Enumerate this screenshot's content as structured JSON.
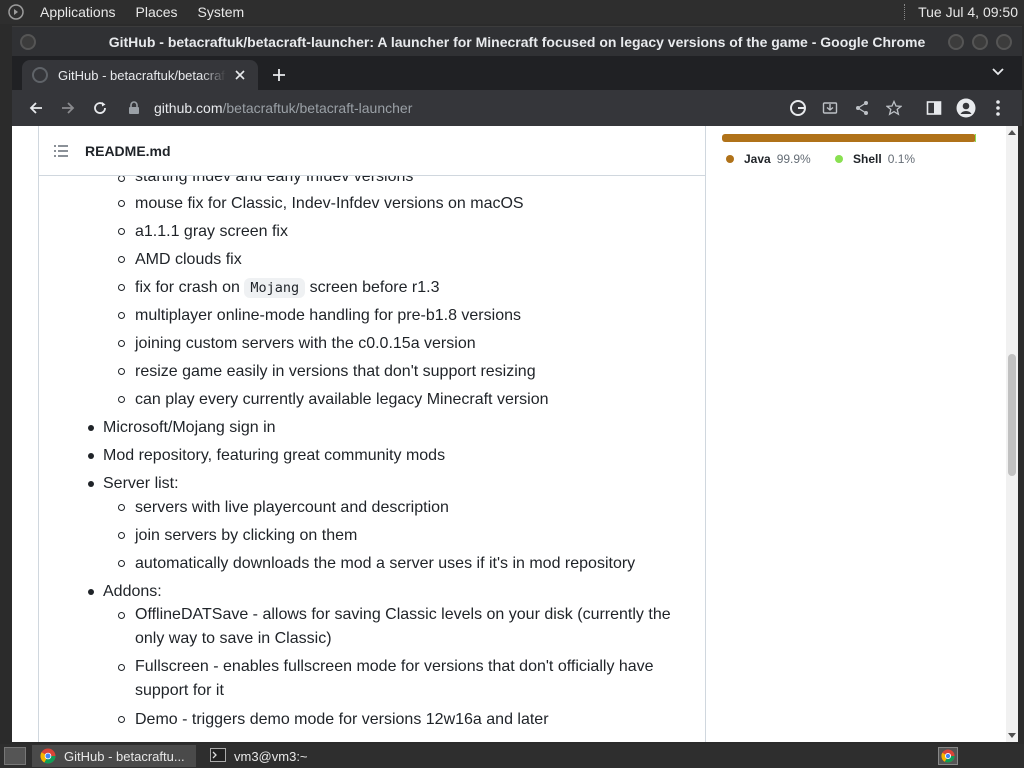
{
  "top_panel": {
    "menus": [
      "Applications",
      "Places",
      "System"
    ],
    "clock": "Tue Jul  4, 09:50"
  },
  "window": {
    "title": "GitHub - betacraftuk/betacraft-launcher: A launcher for Minecraft focused on legacy versions of the game - Google Chrome"
  },
  "browser": {
    "tab_title": "GitHub - betacraftuk/betacraft-launcher: A launcher for Minecraft focused on legacy versions of the game",
    "url_host": "github.com",
    "url_path": "/betacraftuk/betacraft-launcher"
  },
  "readme": {
    "filename": "README.md",
    "items": [
      {
        "level": 2,
        "text": "starting Indev and early Infdev versions"
      },
      {
        "level": 2,
        "text": "mouse fix for Classic, Indev-Infdev versions on macOS"
      },
      {
        "level": 2,
        "text": "a1.1.1 gray screen fix"
      },
      {
        "level": 2,
        "text": "AMD clouds fix"
      },
      {
        "level": 2,
        "pre": "fix for crash on",
        "code": "Mojang",
        "post": "screen before r1.3"
      },
      {
        "level": 2,
        "text": "multiplayer online-mode handling for pre-b1.8 versions"
      },
      {
        "level": 2,
        "text": "joining custom servers with the c0.0.15a version"
      },
      {
        "level": 2,
        "text": "resize game easily in versions that don't support resizing"
      },
      {
        "level": 2,
        "text": "can play every currently available legacy Minecraft version"
      },
      {
        "level": 1,
        "text": "Microsoft/Mojang sign in"
      },
      {
        "level": 1,
        "text": "Mod repository, featuring great community mods"
      },
      {
        "level": 1,
        "text": "Server list:"
      },
      {
        "level": 2,
        "text": "servers with live playercount and description"
      },
      {
        "level": 2,
        "text": "join servers by clicking on them"
      },
      {
        "level": 2,
        "text": "automatically downloads the mod a server uses if it's in mod repository"
      },
      {
        "level": 1,
        "text": "Addons:"
      },
      {
        "level": 2,
        "text": "OfflineDATSave - allows for saving Classic levels on your disk (currently the only way to save in Classic)"
      },
      {
        "level": 2,
        "text": "Fullscreen - enables fullscreen mode for versions that don't officially have support for it"
      },
      {
        "level": 2,
        "text": "Demo - triggers demo mode for versions 12w16a and later"
      }
    ]
  },
  "languages": [
    {
      "name": "Java",
      "percent": "99.9%",
      "share": 0.999,
      "color": "#b07219"
    },
    {
      "name": "Shell",
      "percent": "0.1%",
      "share": 0.001,
      "color": "#89e051"
    }
  ],
  "taskbar": {
    "tasks": [
      "GitHub - betacraftu...",
      "vm3@vm3:~"
    ]
  }
}
